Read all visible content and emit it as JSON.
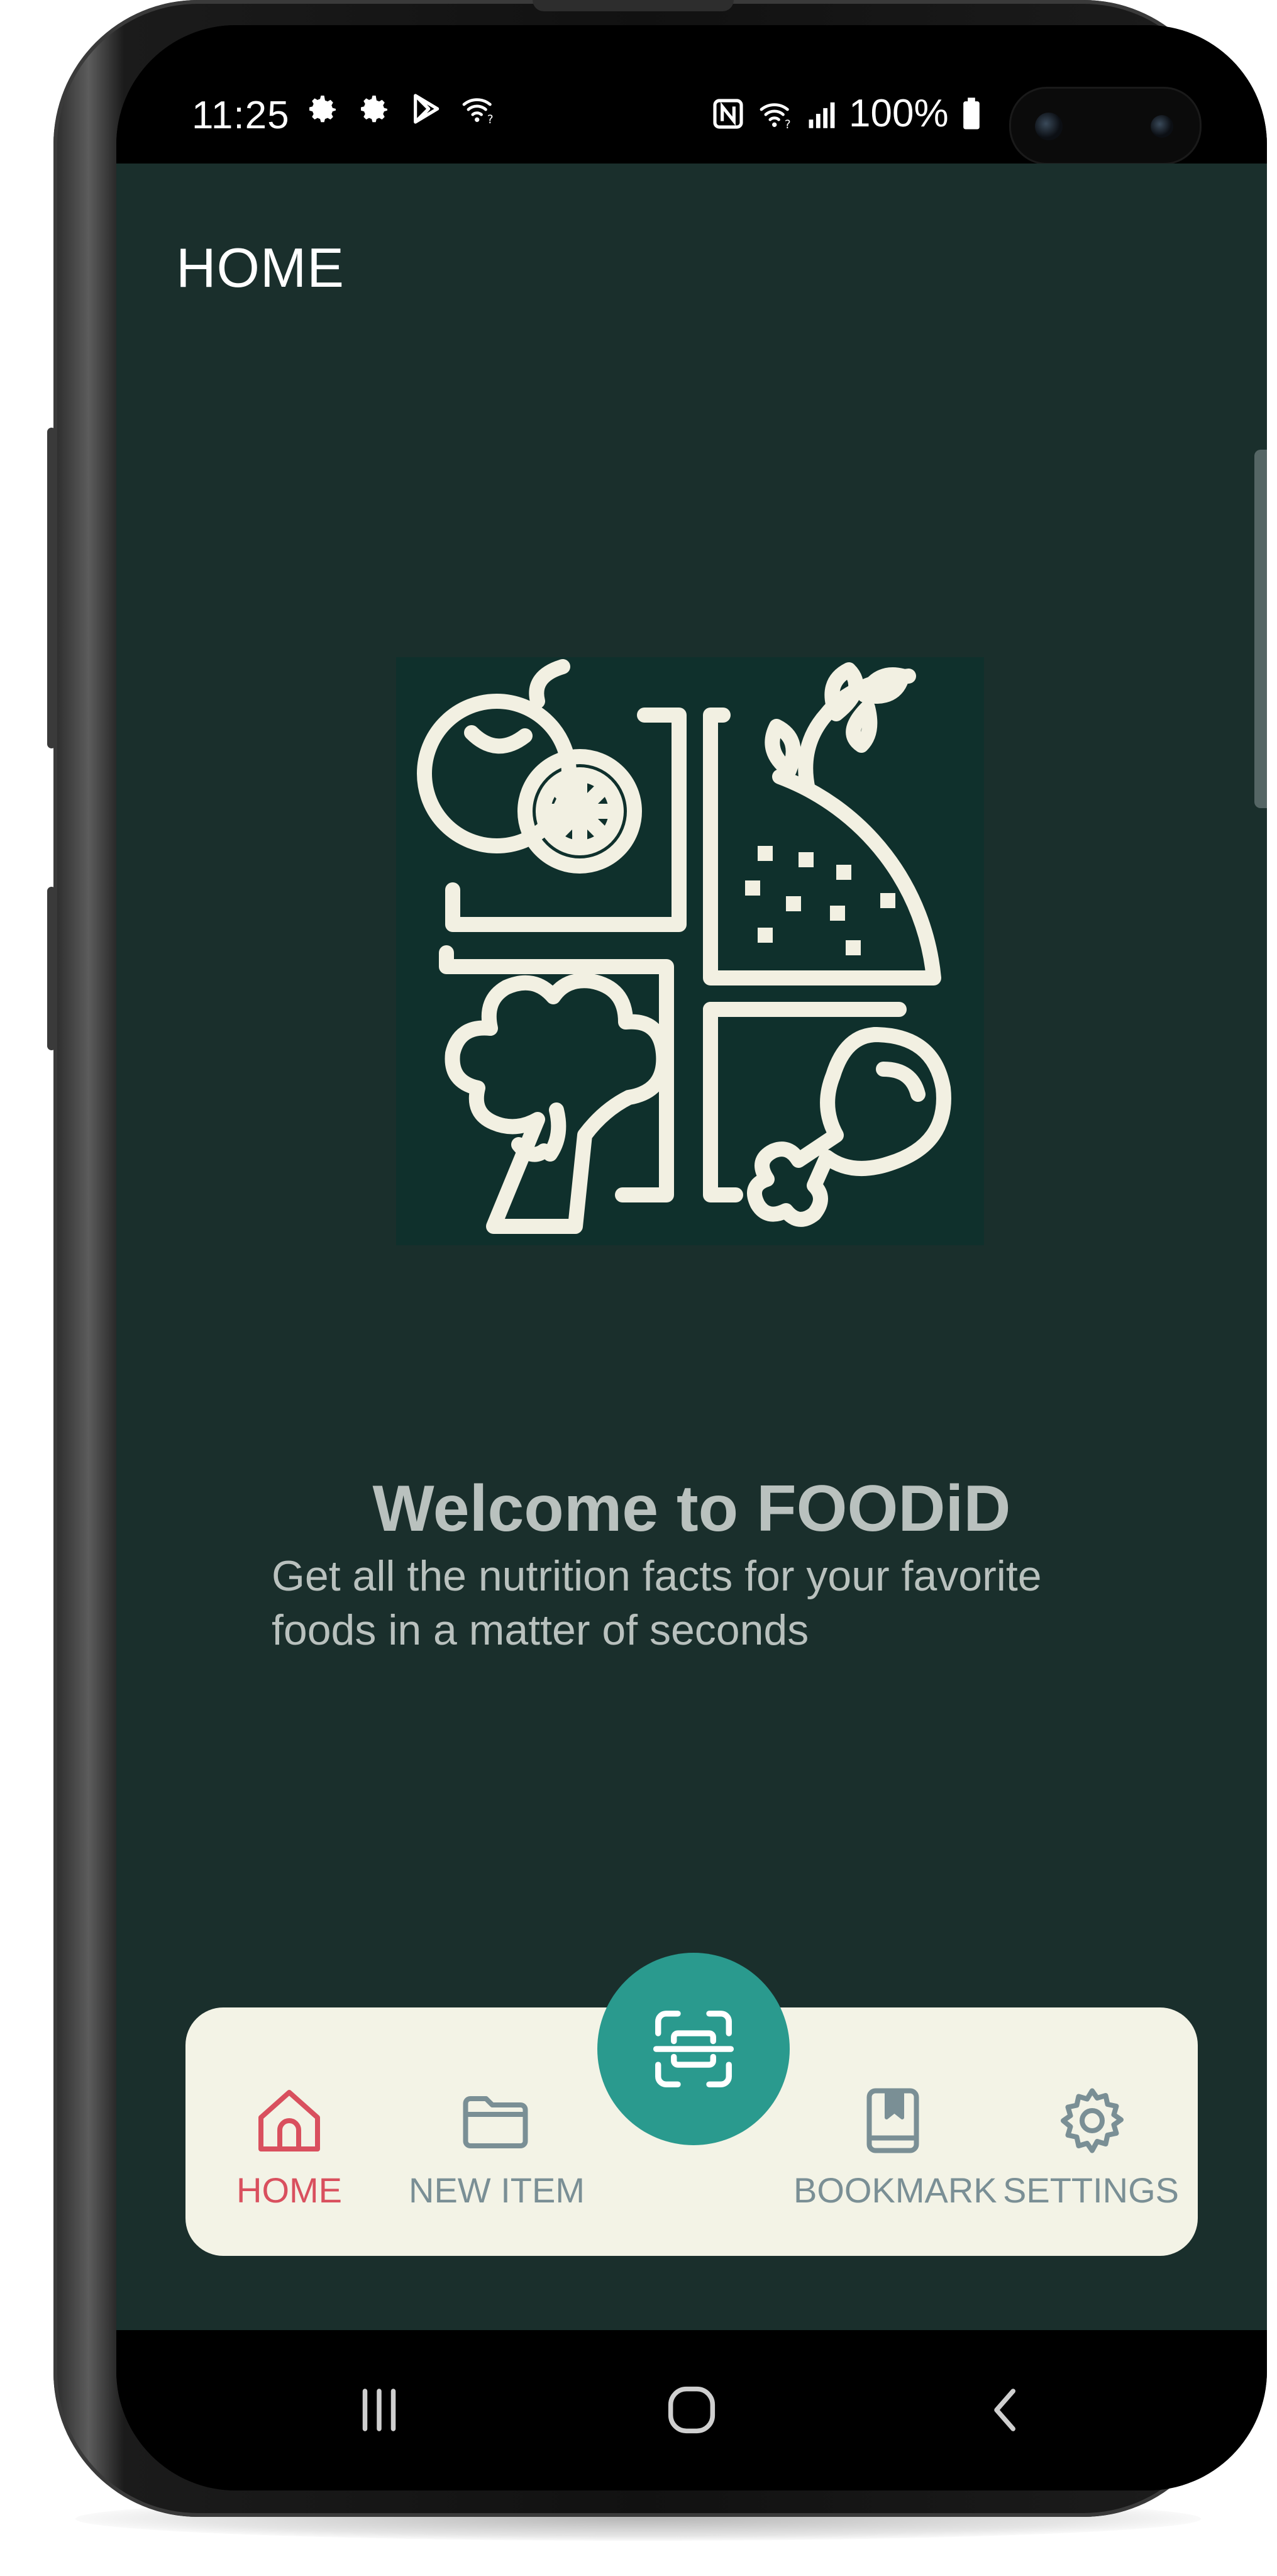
{
  "statusbar": {
    "time": "11:25",
    "battery": "100%",
    "left_icons": [
      "settings-icon",
      "settings-icon",
      "play-store-icon",
      "wifi-call-icon"
    ],
    "right_icons": [
      "nfc-icon",
      "wifi-icon",
      "signal-icon",
      "battery-icon"
    ]
  },
  "header": {
    "title": "HOME"
  },
  "hero": {
    "icon": "food-groups-illustration"
  },
  "welcome": {
    "title": "Welcome to FOODiD",
    "subtitle_line1": "Get all the nutrition facts for your favorite",
    "subtitle_line2": "foods in a matter of seconds"
  },
  "bottom_nav": {
    "items": [
      {
        "label": "HOME",
        "icon": "home-icon",
        "active": true
      },
      {
        "label": "NEW ITEM",
        "icon": "folder-icon",
        "active": false
      },
      {
        "label": "BOOKMARK",
        "icon": "bookmark-icon",
        "active": false
      },
      {
        "label": "SETTINGS",
        "icon": "gear-icon",
        "active": false
      }
    ],
    "fab_icon": "scan-icon"
  },
  "system_nav": {
    "buttons": [
      "recents-icon",
      "home-circle-icon",
      "back-icon"
    ]
  },
  "colors": {
    "background": "#1a2f2c",
    "nav_background": "#f3f3e6",
    "active": "#d9505e",
    "inactive": "#7a8f95",
    "fab": "#2a9a8e",
    "illustration": "#f2f0e2"
  }
}
